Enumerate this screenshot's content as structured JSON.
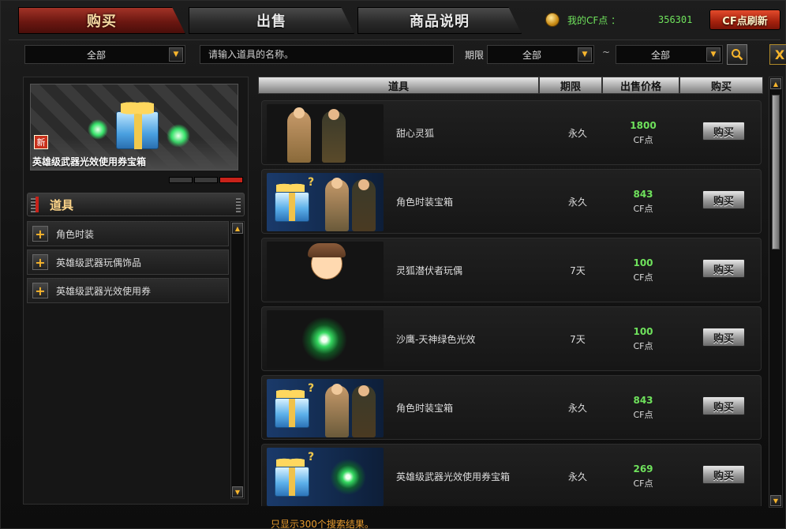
{
  "tabs": [
    {
      "label": "购买",
      "active": true
    },
    {
      "label": "出售",
      "active": false
    },
    {
      "label": "商品说明",
      "active": false
    }
  ],
  "account": {
    "cf_label": "我的CF点 ：",
    "cf_value": "356301",
    "refresh_label": "CF点刷新",
    "coin_icon": "coin-icon"
  },
  "filters": {
    "category": "全部",
    "search_placeholder": "请输入道具的名称。",
    "period_label": "期限",
    "period_from": "全部",
    "tilde": "~",
    "period_to": "全部",
    "search_icon": "search-icon",
    "close_label": "X"
  },
  "preview": {
    "new_badge": "新",
    "item_name": "英雄级武器光效使用券宝箱"
  },
  "category_panel": {
    "header": "道具",
    "items": [
      "角色时装",
      "英雄级武器玩偶饰品",
      "英雄级武器光效使用券"
    ]
  },
  "table": {
    "headers": [
      "道具",
      "期限",
      "出售价格",
      "购买"
    ],
    "buy_label": "购买",
    "unit": "CF点",
    "rows": [
      {
        "name": "甜心灵狐",
        "period": "永久",
        "price": "1800",
        "thumb": "female-characters"
      },
      {
        "name": "角色时装宝箱",
        "period": "永久",
        "price": "843",
        "thumb": "gift-box-characters"
      },
      {
        "name": "灵狐潜伏者玩偶",
        "period": "7天",
        "price": "100",
        "thumb": "doll"
      },
      {
        "name": "沙鹰-天神绿色光效",
        "period": "7天",
        "price": "100",
        "thumb": "green-glow"
      },
      {
        "name": "角色时装宝箱",
        "period": "永久",
        "price": "843",
        "thumb": "gift-box-characters"
      },
      {
        "name": "英雄级武器光效使用券宝箱",
        "period": "永久",
        "price": "269",
        "thumb": "gift-box-glow"
      }
    ]
  },
  "footer": {
    "note": "只显示300个搜索结果。"
  },
  "colors": {
    "accent_red": "#a23327",
    "price_green": "#6fe25c",
    "gold": "#f7b52c",
    "note_orange": "#e69a2d"
  }
}
